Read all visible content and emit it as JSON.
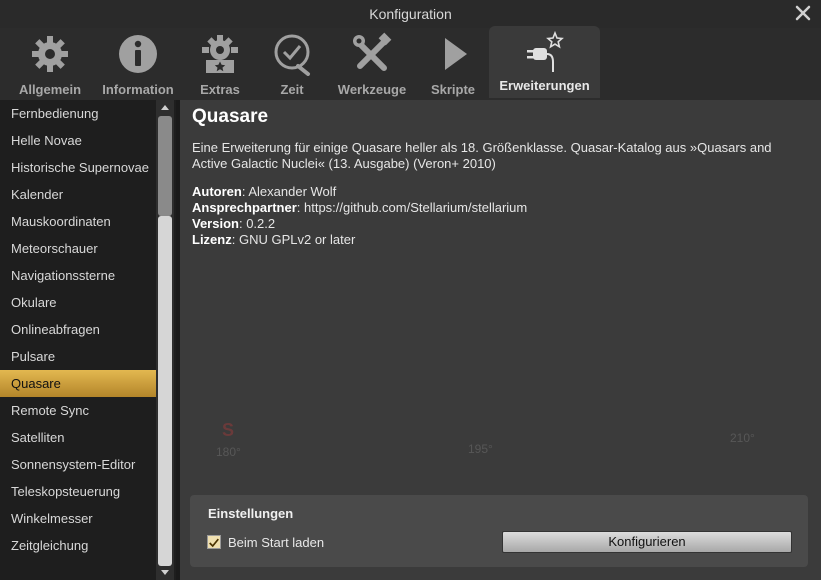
{
  "window": {
    "title": "Konfiguration",
    "close_icon": "close-icon"
  },
  "tabs": [
    {
      "label": "Allgemein",
      "icon": "gear-icon"
    },
    {
      "label": "Information",
      "icon": "info-icon"
    },
    {
      "label": "Extras",
      "icon": "extras-gear-star-icon"
    },
    {
      "label": "Zeit",
      "icon": "clock-icon"
    },
    {
      "label": "Werkzeuge",
      "icon": "tools-icon"
    },
    {
      "label": "Skripte",
      "icon": "play-icon"
    },
    {
      "label": "Erweiterungen",
      "icon": "plugin-star-icon",
      "active": true
    }
  ],
  "sidebar": {
    "items": [
      "Fernbedienung",
      "Helle Novae",
      "Historische Supernovae",
      "Kalender",
      "Mauskoordinaten",
      "Meteorschauer",
      "Navigationssterne",
      "Okulare",
      "Onlineabfragen",
      "Pulsare",
      "Quasare",
      "Remote Sync",
      "Satelliten",
      "Sonnensystem-Editor",
      "Teleskopsteuerung",
      "Winkelmesser",
      "Zeitgleichung"
    ],
    "selected": "Quasare"
  },
  "plugin": {
    "title": "Quasare",
    "description": "Eine Erweiterung für einige Quasare heller als 18. Größenklasse. Quasar-Katalog aus »Quasars and Active Galactic Nuclei« (13. Ausgabe) (Veron+ 2010)",
    "authors_label": "Autoren",
    "authors": "Alexander Wolf",
    "contact_label": "Ansprechpartner",
    "contact": "https://github.com/Stellarium/stellarium",
    "version_label": "Version",
    "version": "0.2.2",
    "license_label": "Lizenz",
    "license": "GNU GPLv2 or later"
  },
  "background": {
    "compass_s": "S",
    "deg_180": "180°",
    "deg_195": "195°",
    "deg_210": "210°"
  },
  "settings": {
    "title": "Einstellungen",
    "load_at_start_label": "Beim Start laden",
    "load_at_start_checked": true,
    "configure_button": "Konfigurieren"
  },
  "colors": {
    "accent": "#d4a43a",
    "panel": "#3b3b3b",
    "sidebar": "#1e1e1e"
  }
}
